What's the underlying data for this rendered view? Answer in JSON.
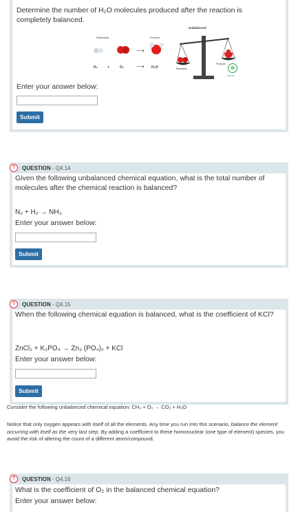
{
  "q13": {
    "text": "Determine the number of H₂O molecules produced after the reaction is completely balanced.",
    "figure": {
      "reactants_label": "Reactants",
      "product_label": "Product",
      "unbalanced_label": "Unbalanced",
      "products_label": "Products",
      "reactants2_label": "Reactants",
      "h2": "H₂",
      "plus": "+",
      "o2": "O₂",
      "h2o": "H₂O",
      "magnify_label": "Magnify"
    },
    "prompt": "Enter your answer below:",
    "submit": "Submit"
  },
  "q14": {
    "title": "QUESTION",
    "num": "- Q4.14",
    "text": "Given the following unbalanced chemical equation, what is the total number of molecules after the chemical reaction is balanced?",
    "equation": "N₂ + H₂ → NH₃",
    "prompt": "Enter your answer below:",
    "submit": "Submit"
  },
  "q15": {
    "title": "QUESTION",
    "num": "- Q4.15",
    "text": "When the following chemical equation is balanced, what is the coefficient of KCl?",
    "equation": "ZnCl₂ + K₃PO₄ → Zn₃ (PO₄)₂ + KCl",
    "prompt": "Enter your answer below:",
    "submit": "Submit"
  },
  "note": {
    "line1": "Consider the following unbalanced chemical equation: CH₄ + O₂ → CO₂ + H₂O",
    "para_a": "Notice that only oxygen appears with itself of all the elements. Any time you run into this scenario, ",
    "para_em": "balance the element occurring with itself as the very last step.",
    "para_b": " By adding a coefficient to these homonuclear (one type of element) species, you avoid the risk of altering the count of a different atom/compound."
  },
  "q16": {
    "title": "QUESTION",
    "num": "- Q4.16",
    "text": "What is the coefficient of O₂ in the balanced chemical equation?",
    "prompt": "Enter your answer below:"
  },
  "colors": {
    "accent": "#2d6ea4",
    "header": "#dce6ea",
    "icon": "#e3343c"
  }
}
